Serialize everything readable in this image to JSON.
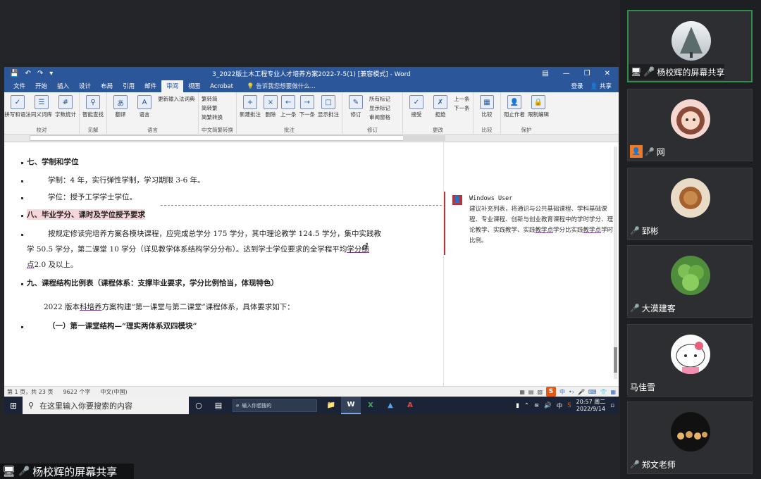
{
  "word": {
    "title": "3_2022版土木工程专业人才培养方案2022-7-5(1) [兼容模式] - Word",
    "tabs": [
      "文件",
      "开始",
      "插入",
      "设计",
      "布局",
      "引用",
      "邮件",
      "审阅",
      "视图",
      "Acrobat"
    ],
    "active_tab": "审阅",
    "tell_me": "告诉我您想要做什么...",
    "login": "登录",
    "share": "共享",
    "ribbon_groups": [
      {
        "name": "校对",
        "buttons": [
          "拼写和语法",
          "同义词库",
          "字数统计"
        ]
      },
      {
        "name": "见解",
        "buttons": [
          "智能查找"
        ]
      },
      {
        "name": "语言",
        "buttons": [
          "翻译",
          "语言"
        ],
        "small": [
          "更新输入法词典"
        ]
      },
      {
        "name": "中文简繁转换",
        "small": [
          "繁转简",
          "简转繁",
          "简繁转换"
        ]
      },
      {
        "name": "批注",
        "buttons": [
          "新建批注",
          "删除",
          "上一条",
          "下一条",
          "显示批注"
        ]
      },
      {
        "name": "修订",
        "buttons": [
          "修订"
        ],
        "small": [
          "所有标记",
          "显示标记",
          "审阅窗格"
        ]
      },
      {
        "name": "更改",
        "buttons": [
          "接受",
          "拒绝"
        ],
        "small": [
          "上一条",
          "下一条"
        ]
      },
      {
        "name": "比较",
        "buttons": [
          "比较"
        ]
      },
      {
        "name": "保护",
        "buttons": [
          "阻止作者",
          "限制编辑"
        ]
      }
    ],
    "doc": {
      "h7": "七、学制和学位",
      "p7a": "学制：4 年，实行弹性学制，学习期限 3-6 年。",
      "p7b": "学位：授予工学学士学位。",
      "h8": "八、毕业学分、课时及学位授予要求",
      "p8_line1": "按规定修读完培养方案各模块课程，应完成总学分 175 学分，其中理论教学 124.5 学分，集中实践教",
      "p8_line2_a": "学 50.5 学分，第二课堂 10 学分（详见教学体系结构学分分布）。达到学士学位要求的全学程平均",
      "p8_line2_u": "学分绩",
      "p8_line3_u": "点",
      "p8_line3_b": "2.0 及以上。",
      "h9": "九、课程结构比例表（课程体系：支撑毕业要求，学分比例恰当，体现特色）",
      "p9_a": "2022 版本",
      "p9_u": "科培养",
      "p9_b": "方案构建“第一课堂与第二课堂”课程体系，具体要求如下：",
      "p9_sub": "（一）第一课堂结构—“理实两体系双四模块”"
    },
    "comment": {
      "author": "Windows User",
      "text_a": "建议补充列表，将通识与公共基础课程、学科基础课程、专业课程、创新与创业教育课程中的学时学分、理论教学、实践教学、实践",
      "text_u1": "教学点",
      "text_b": "学分比实践",
      "text_u2": "教学点",
      "text_c": "学时比例。"
    },
    "status": {
      "page": "第 1 页，共 23 页",
      "words": "9622 个字",
      "lang": "中文(中国)"
    }
  },
  "taskbar": {
    "search_placeholder": "在这里输入你要搜索的内容",
    "mini_search": "输入你想搜的",
    "ime": "中",
    "time": "20:57 周二",
    "date": "2022/9/14"
  },
  "share_label": "杨校辉的屏幕共享",
  "participants": [
    {
      "name": "杨校辉的屏幕共享",
      "speaking": true,
      "avatar_color": "#dfe5ea"
    },
    {
      "name": "网",
      "speaking": false,
      "avatar_color": "#e9a6a0"
    },
    {
      "name": "郅彬",
      "speaking": false,
      "avatar_color": "#c99a6a"
    },
    {
      "name": "大漠建客",
      "speaking": false,
      "avatar_color": "#5f9a4a"
    },
    {
      "name": "马佳雪",
      "speaking": false,
      "avatar_color": "#f4f4f4"
    },
    {
      "name": "郑文老师",
      "speaking": false,
      "avatar_color": "#1a1a1a"
    }
  ],
  "colors": {
    "word_blue": "#2b579a",
    "comment_red": "#b4343f",
    "highlight": "#f7d6da",
    "speaking_border": "#2f8f4a"
  }
}
